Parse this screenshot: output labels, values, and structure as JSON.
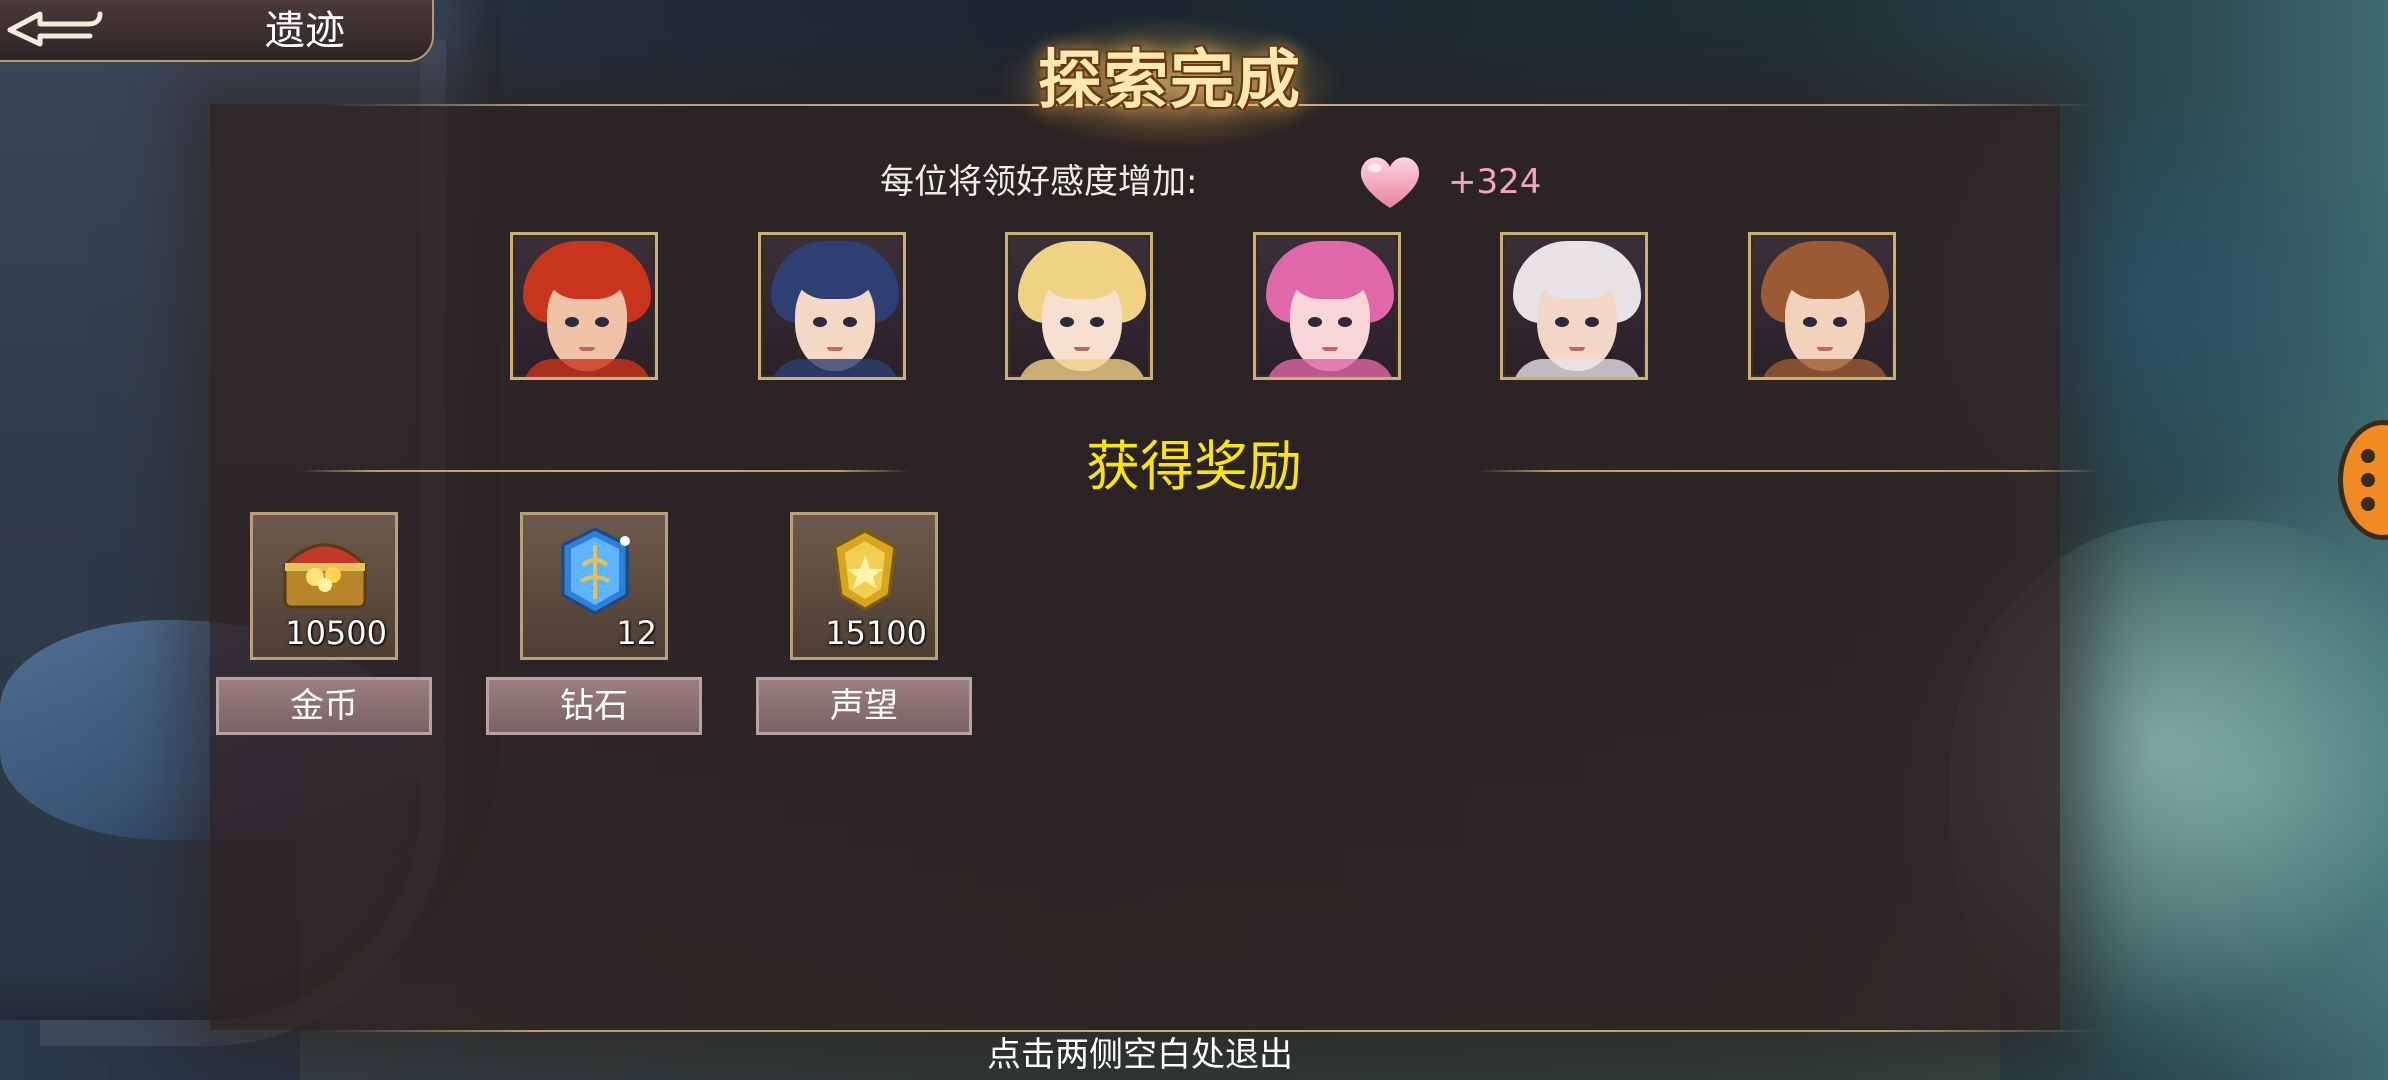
{
  "header": {
    "back_icon": "back-arrow-icon",
    "title": "遗迹"
  },
  "banner": {
    "title": "探索完成"
  },
  "affection": {
    "label": "每位将领好感度增加:",
    "icon": "heart-icon",
    "value": "+324",
    "value_color": "#f0a3c3"
  },
  "heroes": [
    {
      "name": "hero-portrait-1",
      "hair": "#c8341c",
      "skin": "#f1c3a6"
    },
    {
      "name": "hero-portrait-2",
      "hair": "#2d3f73",
      "skin": "#f4d8c6"
    },
    {
      "name": "hero-portrait-3",
      "hair": "#f0d284",
      "skin": "#f8e0d0"
    },
    {
      "name": "hero-portrait-4",
      "hair": "#e067a8",
      "skin": "#f8d6d8"
    },
    {
      "name": "hero-portrait-5",
      "hair": "#e6e2e6",
      "skin": "#f2d6c8"
    },
    {
      "name": "hero-portrait-6",
      "hair": "#9b5a33",
      "skin": "#f3d2bc"
    }
  ],
  "rewards": {
    "title": "获得奖励",
    "title_color": "#f8e60a",
    "items": [
      {
        "icon": "treasure-chest-icon",
        "count": "10500",
        "label": "金币"
      },
      {
        "icon": "blue-crystal-icon",
        "count": "12",
        "label": "钻石"
      },
      {
        "icon": "gold-medal-icon",
        "count": "15100",
        "label": "声望"
      }
    ]
  },
  "footer": {
    "hint": "点击两侧空白处退出"
  },
  "side_button": {
    "icon": "paw-icon",
    "color": "#f08a22"
  }
}
